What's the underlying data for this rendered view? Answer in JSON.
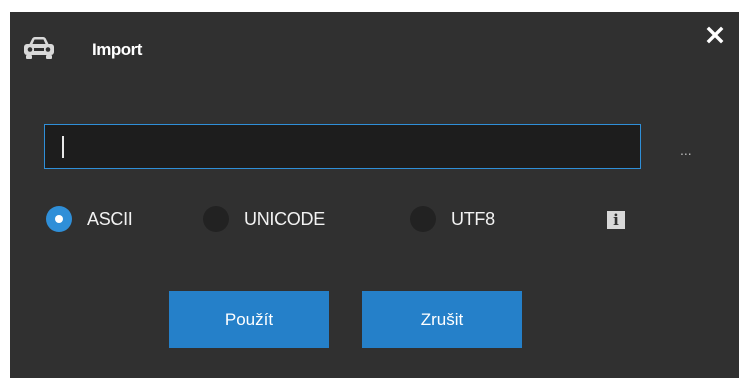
{
  "dialog": {
    "title": "Import",
    "title_icon": "car-icon",
    "close_icon": "close-icon",
    "accent_color": "#2f8fd8",
    "background_color": "#303030"
  },
  "path_field": {
    "value": "",
    "placeholder": "",
    "browse_label": "..."
  },
  "encoding": {
    "selected": "ASCII",
    "options": [
      {
        "label": "ASCII",
        "checked": true
      },
      {
        "label": "UNICODE",
        "checked": false
      },
      {
        "label": "UTF8",
        "checked": false
      }
    ],
    "info_icon": "info-icon",
    "info_glyph": "i"
  },
  "buttons": {
    "apply_label": "Použít",
    "cancel_label": "Zrušit"
  }
}
